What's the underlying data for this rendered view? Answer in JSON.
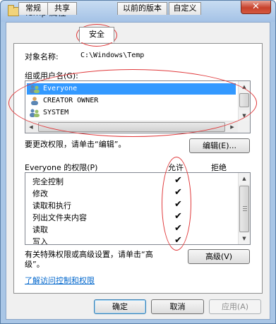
{
  "window": {
    "title": "Temp 属性",
    "close_glyph": "✕"
  },
  "tabs": [
    {
      "label": "常规"
    },
    {
      "label": "共享"
    },
    {
      "label": "安全",
      "active": true
    },
    {
      "label": "以前的版本"
    },
    {
      "label": "自定义"
    }
  ],
  "security": {
    "object_name_label": "对象名称:",
    "object_name_value": "C:\\Windows\\Temp",
    "groups_label": "组或用户名(G):",
    "users": [
      {
        "name": "Everyone",
        "selected": true
      },
      {
        "name": "CREATOR OWNER",
        "selected": false
      },
      {
        "name": "SYSTEM",
        "selected": false
      }
    ],
    "change_perm_text": "要更改权限，请单击“编辑”。",
    "edit_button": "编辑(E)...",
    "perm_header": "Everyone 的权限(P)",
    "allow_header": "允许",
    "deny_header": "拒绝",
    "permissions": [
      {
        "name": "完全控制",
        "allow": "✔"
      },
      {
        "name": "修改",
        "allow": "✔"
      },
      {
        "name": "读取和执行",
        "allow": "✔"
      },
      {
        "name": "列出文件夹内容",
        "allow": "✔"
      },
      {
        "name": "读取",
        "allow": "✔"
      },
      {
        "name": "写入",
        "allow": "✔"
      }
    ],
    "special_text_line1": "有关特殊权限或高级设置，请单击“高",
    "special_text_line2": "级”。",
    "advanced_button": "高级(V)",
    "learn_link": "了解访问控制和权限"
  },
  "footer": {
    "ok_button": "确定",
    "cancel_button": "取消",
    "apply_button": "应用(A)"
  },
  "colors": {
    "selection": "#3399ff",
    "annotation": "#e0383a",
    "link": "#0066cc"
  }
}
